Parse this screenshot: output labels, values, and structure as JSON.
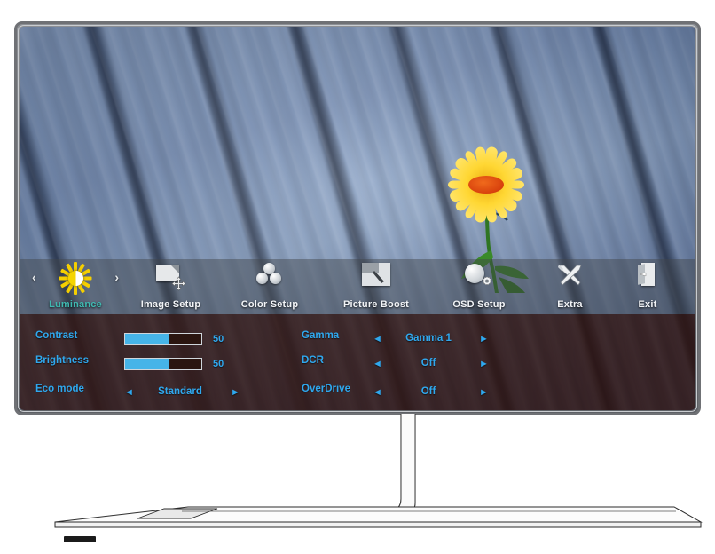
{
  "device": {
    "type": "computer-monitor",
    "osd_title": "Luminance OSD menu"
  },
  "screen_image": {
    "subject": "yellow flower on weathered blue-gray wooden deck",
    "flower_petal_color": "#ffd733",
    "flower_center_color": "#d8410d",
    "stem_color": "#2c6e20",
    "wood_color": "#8ba2c4"
  },
  "osd": {
    "accent_selected": "#3fb8b0",
    "accent_text": "#2fa8ee",
    "slider_fill": "#46b4e8",
    "menu": [
      {
        "id": "luminance",
        "label": "Luminance",
        "icon": "sun-icon",
        "selected": true
      },
      {
        "id": "image-setup",
        "label": "Image Setup",
        "icon": "image-setup-icon",
        "selected": false
      },
      {
        "id": "color-setup",
        "label": "Color Setup",
        "icon": "color-spheres-icon",
        "selected": false
      },
      {
        "id": "picture-boost",
        "label": "Picture Boost",
        "icon": "picture-boost-icon",
        "selected": false
      },
      {
        "id": "osd-setup",
        "label": "OSD Setup",
        "icon": "osd-setup-icon",
        "selected": false
      },
      {
        "id": "extra",
        "label": "Extra",
        "icon": "tools-icon",
        "selected": false
      },
      {
        "id": "exit",
        "label": "Exit",
        "icon": "exit-door-icon",
        "selected": false
      }
    ],
    "nav": {
      "prev_arrow": "‹",
      "next_arrow": "›",
      "left_arrow": "◄",
      "right_arrow": "►"
    },
    "settings_left": [
      {
        "id": "contrast",
        "label": "Contrast",
        "control": "slider",
        "value": "50",
        "percent": 57
      },
      {
        "id": "brightness",
        "label": "Brightness",
        "control": "slider",
        "value": "50",
        "percent": 57
      },
      {
        "id": "eco-mode",
        "label": "Eco mode",
        "control": "option",
        "value": "Standard"
      }
    ],
    "settings_right": [
      {
        "id": "gamma",
        "label": "Gamma",
        "control": "option",
        "value": "Gamma 1"
      },
      {
        "id": "dcr",
        "label": "DCR",
        "control": "option",
        "value": "Off"
      },
      {
        "id": "overdrive",
        "label": "OverDrive",
        "control": "option",
        "value": "Off"
      }
    ]
  }
}
